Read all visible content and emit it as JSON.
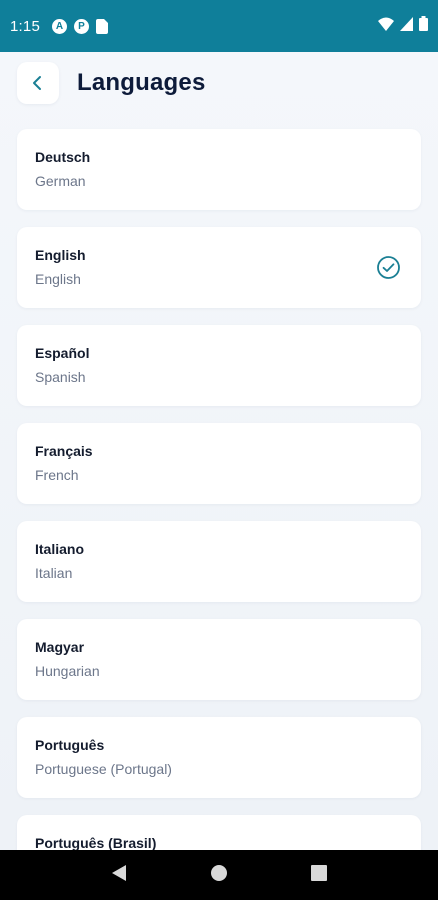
{
  "status_bar": {
    "time": "1:15",
    "left_icons": [
      "a-circle-icon",
      "p-circle-icon",
      "sim-card-icon"
    ],
    "right_icons": [
      "wifi-icon",
      "signal-icon",
      "battery-icon"
    ]
  },
  "header": {
    "title": "Languages",
    "back_icon": "chevron-left-icon"
  },
  "languages": [
    {
      "native": "Deutsch",
      "english": "German",
      "selected": false
    },
    {
      "native": "English",
      "english": "English",
      "selected": true
    },
    {
      "native": "Español",
      "english": "Spanish",
      "selected": false
    },
    {
      "native": "Français",
      "english": "French",
      "selected": false
    },
    {
      "native": "Italiano",
      "english": "Italian",
      "selected": false
    },
    {
      "native": "Magyar",
      "english": "Hungarian",
      "selected": false
    },
    {
      "native": "Português",
      "english": "Portuguese (Portugal)",
      "selected": false
    },
    {
      "native": "Português (Brasil)",
      "english": "",
      "selected": false
    }
  ],
  "colors": {
    "status_bar": "#0f7f9a",
    "accent": "#1a7f94",
    "title": "#0d1b3a",
    "background": "#eef2f8"
  },
  "nav_bar": {
    "icons": [
      "back-triangle-icon",
      "home-circle-icon",
      "recents-square-icon"
    ]
  }
}
